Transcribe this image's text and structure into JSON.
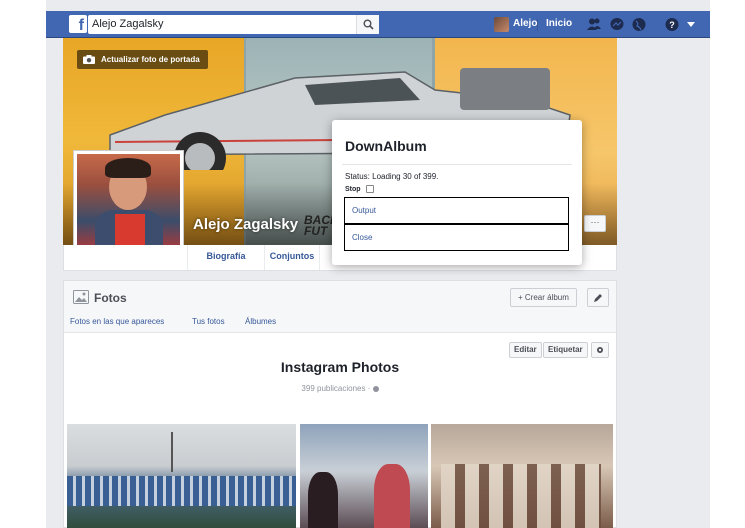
{
  "topbar": {
    "search_value": "Alejo Zagalsky",
    "user_name": "Alejo",
    "home_label": "Inicio",
    "logo_glyph": "f"
  },
  "cover": {
    "update_button_label": "Actualizar foto de portada",
    "profile_name": "Alejo Zagalsky",
    "overlay_logo_text": "BACK FUT",
    "more_button": "···"
  },
  "tabs": [
    "Biografía",
    "Conjuntos"
  ],
  "dialog": {
    "title": "DownAlbum",
    "status": "Status: Loading 30 of 399.",
    "stop_label": "Stop",
    "output_button": "Output",
    "close_button": "Close"
  },
  "fotos": {
    "title": "Fotos",
    "create_album_label": "+ Crear álbum",
    "subnav": [
      "Fotos en las que apareces",
      "Tus fotos",
      "Álbumes"
    ],
    "edit_label": "Editar",
    "tag_label": "Etiquetar",
    "album_title": "Instagram Photos",
    "album_count": "399 publicaciones · "
  },
  "colors": {
    "fb_blue": "#4267b2",
    "link_blue": "#365899",
    "page_bg": "#e9ebee"
  }
}
